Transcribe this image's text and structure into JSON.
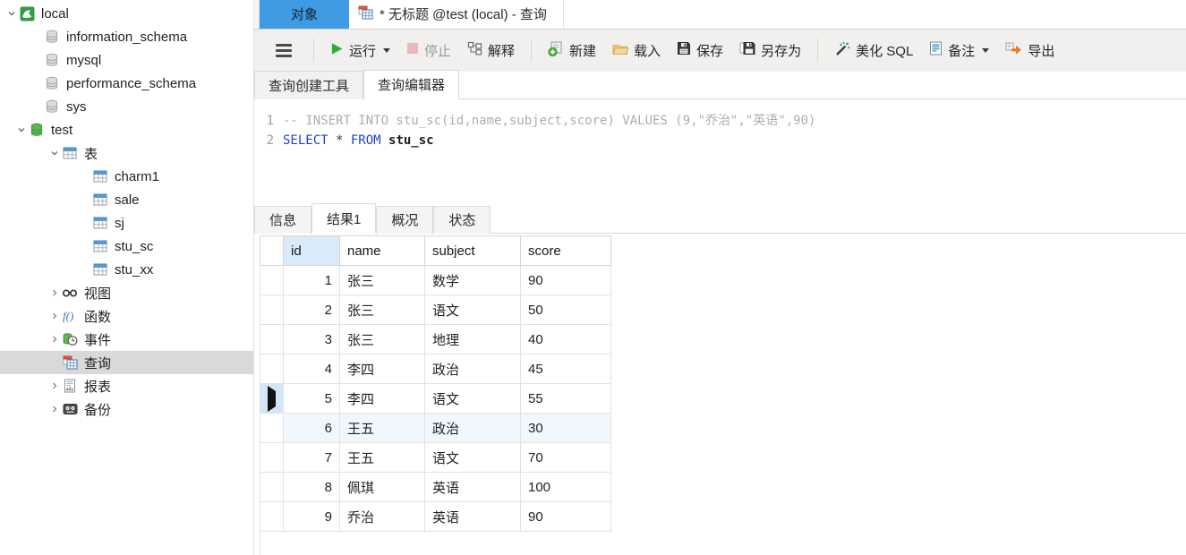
{
  "colors": {
    "accent_blue": "#3e9ae2",
    "run_green": "#2fae37",
    "stop_pink": "#e8b7b7",
    "export_orange": "#f07a1e",
    "query_icon_red": "#e2593c",
    "table_header_blue": "#5b9bd5",
    "db_green": "#58b54a",
    "tree_selected_gray": "#d9d9d9",
    "id_header_bg": "#d9ebfa",
    "current_row_marker_bg": "#d2e6f8",
    "hover_row_bg": "#f0f8fe"
  },
  "icons": {
    "connection-icon": "green-square-white-dolphin",
    "database-icon": "gray-cylinder-stack",
    "database-open-icon": "green-cylinder-stack",
    "table-icon": "grid-with-blue-header",
    "views-icon": "glasses",
    "functions-icon": "italic-f-parentheses",
    "events-icon": "cylinder-with-clock",
    "query-icon": "window-red-bar-blue-grid",
    "report-icon": "page-with-mini-bars",
    "backup-icon": "dark-cassette-two-dots",
    "menu-icon": "hamburger-three-bars",
    "run-icon": "green-play-triangle",
    "stop-icon": "pink-square",
    "explain-icon": "linked-boxes",
    "new-icon": "sheet-with-green-plus",
    "load-icon": "tan-folder",
    "save-icon": "black-floppy",
    "save-as-icon": "floppy-with-sheet",
    "beautify-icon": "magic-wand-sparkles",
    "note-icon": "page-teal-lines",
    "export-icon": "orange-right-arrow-grid",
    "chevron-down-icon": "expanded",
    "chevron-right-icon": "collapsed",
    "row-marker-icon": "black-right-triangle"
  },
  "sidebar": {
    "items": [
      {
        "label": "local"
      },
      {
        "label": "information_schema"
      },
      {
        "label": "mysql"
      },
      {
        "label": "performance_schema"
      },
      {
        "label": "sys"
      },
      {
        "label": "test"
      },
      {
        "label": "表"
      },
      {
        "label": "charm1"
      },
      {
        "label": "sale"
      },
      {
        "label": "sj"
      },
      {
        "label": "stu_sc"
      },
      {
        "label": "stu_xx"
      },
      {
        "label": "视图"
      },
      {
        "label": "函数"
      },
      {
        "label": "事件"
      },
      {
        "label": "查询"
      },
      {
        "label": "报表"
      },
      {
        "label": "备份"
      }
    ]
  },
  "tabs": {
    "objects": "对象",
    "query": "* 无标题 @test (local) - 查询"
  },
  "toolbar": {
    "run": "运行",
    "stop": "停止",
    "explain": "解释",
    "new": "新建",
    "load": "载入",
    "save": "保存",
    "save_as": "另存为",
    "beautify": "美化 SQL",
    "note": "备注",
    "export": "导出"
  },
  "subtabs": {
    "builder": "查询创建工具",
    "editor": "查询编辑器"
  },
  "editor": {
    "line_numbers": [
      "1",
      "2"
    ],
    "comment_line": "-- INSERT INTO stu_sc(id,name,subject,score) VALUES (9,\"乔治\",\"英语\",90)",
    "select_kw": "SELECT",
    "star": " * ",
    "from_kw": "FROM",
    "table_name": " stu_sc"
  },
  "result_tabs": {
    "info": "信息",
    "result1": "结果1",
    "overview": "概况",
    "status": "状态"
  },
  "results": {
    "columns": [
      "id",
      "name",
      "subject",
      "score"
    ],
    "current_row_id": "5",
    "rows": [
      {
        "id": "1",
        "name": "张三",
        "subject": "数学",
        "score": "90"
      },
      {
        "id": "2",
        "name": "张三",
        "subject": "语文",
        "score": "50"
      },
      {
        "id": "3",
        "name": "张三",
        "subject": "地理",
        "score": "40"
      },
      {
        "id": "4",
        "name": "李四",
        "subject": "政治",
        "score": "45"
      },
      {
        "id": "5",
        "name": "李四",
        "subject": "语文",
        "score": "55"
      },
      {
        "id": "6",
        "name": "王五",
        "subject": "政治",
        "score": "30"
      },
      {
        "id": "7",
        "name": "王五",
        "subject": "语文",
        "score": "70"
      },
      {
        "id": "8",
        "name": "佩琪",
        "subject": "英语",
        "score": "100"
      },
      {
        "id": "9",
        "name": "乔治",
        "subject": "英语",
        "score": "90"
      }
    ]
  }
}
